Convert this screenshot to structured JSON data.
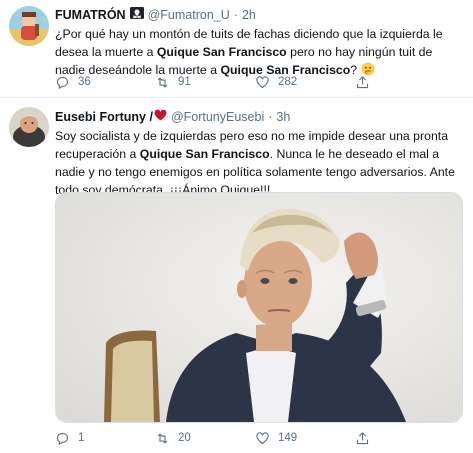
{
  "tweet1": {
    "display_name": "FUMATRÓN",
    "handle": "@Fumatron_U",
    "separator": "·",
    "time": "2h",
    "text_parts": [
      "¿Por qué hay un montón de tuits de fachas diciendo que la izquierda le desea la muerte a ",
      "Quique San Francisco",
      " pero no hay ningún tuit de nadie deseándole la muerte a ",
      "Quique San Francisco",
      "?"
    ],
    "emoji_name": "thinking-face-emoji",
    "badge_icon": "pirate-flag-icon",
    "replies": "36",
    "retweets": "91",
    "likes": "282"
  },
  "tweet2": {
    "display_name": "Eusebi Fortuny /",
    "heart_icon": "red-heart-icon",
    "handle": "@FortunyEusebi",
    "separator": "·",
    "time": "3h",
    "text_parts": [
      "Soy socialista y de izquierdas pero eso no me impide desear una pronta recuperación a ",
      "Quique San Francisco",
      ". Nunca le he deseado el mal a nadie y no tengo enemigos en política solamente tengo adversarios. Ante todo soy demócrata. ¡¡¡Ánimo Quique!!!"
    ],
    "replies": "1",
    "retweets": "20",
    "likes": "149"
  },
  "colors": {
    "text": "#0f1419",
    "secondary": "#5b7083",
    "divider": "#ebeef0",
    "heart": "#c4122f"
  }
}
